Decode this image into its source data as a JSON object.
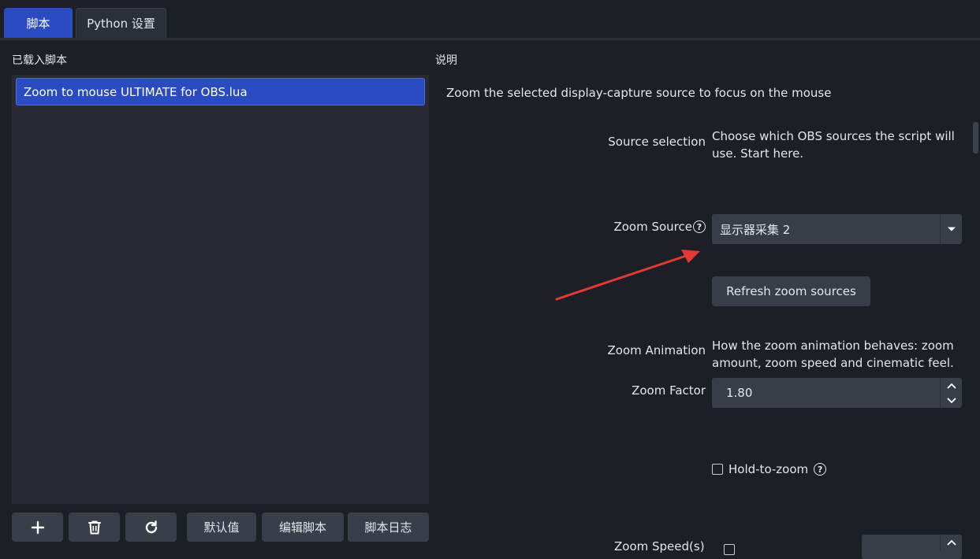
{
  "tabs": [
    {
      "label": "脚本",
      "active": true
    },
    {
      "label": "Python 设置",
      "active": false
    }
  ],
  "loaded_scripts": {
    "label": "已载入脚本",
    "items": [
      "Zoom to mouse ULTIMATE for OBS.lua"
    ]
  },
  "toolbar": {
    "add_icon": "plus-icon",
    "remove_icon": "trash-icon",
    "reload_icon": "refresh-icon",
    "defaults_label": "默认值",
    "edit_label": "编辑脚本",
    "log_label": "脚本日志"
  },
  "description": {
    "label": "说明",
    "text": "Zoom the selected display-capture source to focus on the mouse"
  },
  "properties": {
    "source_selection": {
      "label": "Source selection",
      "text": "Choose which OBS sources the script will use. Start here."
    },
    "zoom_source": {
      "label": "Zoom Source",
      "value": "显示器采集 2"
    },
    "refresh_button": "Refresh zoom sources",
    "zoom_animation": {
      "label": "Zoom Animation",
      "text": "How the zoom animation behaves: zoom amount, zoom speed and cinematic feel."
    },
    "zoom_factor": {
      "label": "Zoom Factor",
      "value": "1.80"
    },
    "hold_to_zoom": {
      "label": "Hold-to-zoom",
      "checked": false
    },
    "partial_label": "Zoom Speed(s)"
  },
  "colors": {
    "accent": "#2a4bc1",
    "background": "#1d1f26",
    "panel": "#272a33",
    "control": "#393d48",
    "annotation_arrow": "#e53935"
  }
}
